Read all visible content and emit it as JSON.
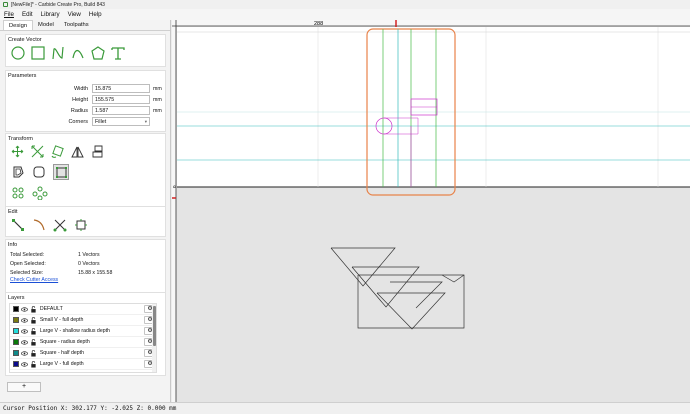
{
  "window": {
    "title": "[NewFile]* - Carbide Create Pro, Build 843"
  },
  "menu": [
    "File",
    "Edit",
    "Library",
    "View",
    "Help"
  ],
  "tabs": [
    "Design",
    "Model",
    "Toolpaths"
  ],
  "create_vector": {
    "title": "Create Vector"
  },
  "parameters": {
    "title": "Parameters",
    "width_label": "Width",
    "width_value": "15.875",
    "width_unit": "mm",
    "height_label": "Height",
    "height_value": "155.575",
    "height_unit": "mm",
    "radius_label": "Radius",
    "radius_value": "1.587",
    "radius_unit": "mm",
    "corners_label": "Corners",
    "corners_value": "Fillet"
  },
  "transform": {
    "title": "Transform"
  },
  "edit": {
    "title": "Edit"
  },
  "info": {
    "title": "Info",
    "total_selected_label": "Total Selected:",
    "total_selected_value": "1 Vectors",
    "open_selected_label": "Open Selected:",
    "open_selected_value": "0 Vectors",
    "selected_size_label": "Selected Size:",
    "selected_size_value": "15.88 x 155.58",
    "check_cutter_link": "Check Cutter Access"
  },
  "layers": {
    "title": "Layers",
    "items": [
      {
        "name": "DEFAULT",
        "color": "#000000"
      },
      {
        "name": "Small V - full depth",
        "color": "#7a7a10"
      },
      {
        "name": "Large V - shallow radius depth",
        "color": "#22dddd"
      },
      {
        "name": "Square - radius depth",
        "color": "#0a7a0a"
      },
      {
        "name": "Square - half depth",
        "color": "#0f8a8a"
      },
      {
        "name": "Large V - full depth",
        "color": "#0a0a8a"
      }
    ],
    "add_label": "+"
  },
  "canvas": {
    "ruler_mark": "288",
    "ruler_zero": "0"
  },
  "status": {
    "text": "Cursor Position X: 302.177 Y: -2.025 Z: 0.000 mm"
  },
  "colors": {
    "selection": "#e8834a",
    "magenta": "#cc33cc",
    "cyan": "#33bbbb",
    "green": "#44bb44",
    "ruler_red": "#d22222"
  }
}
